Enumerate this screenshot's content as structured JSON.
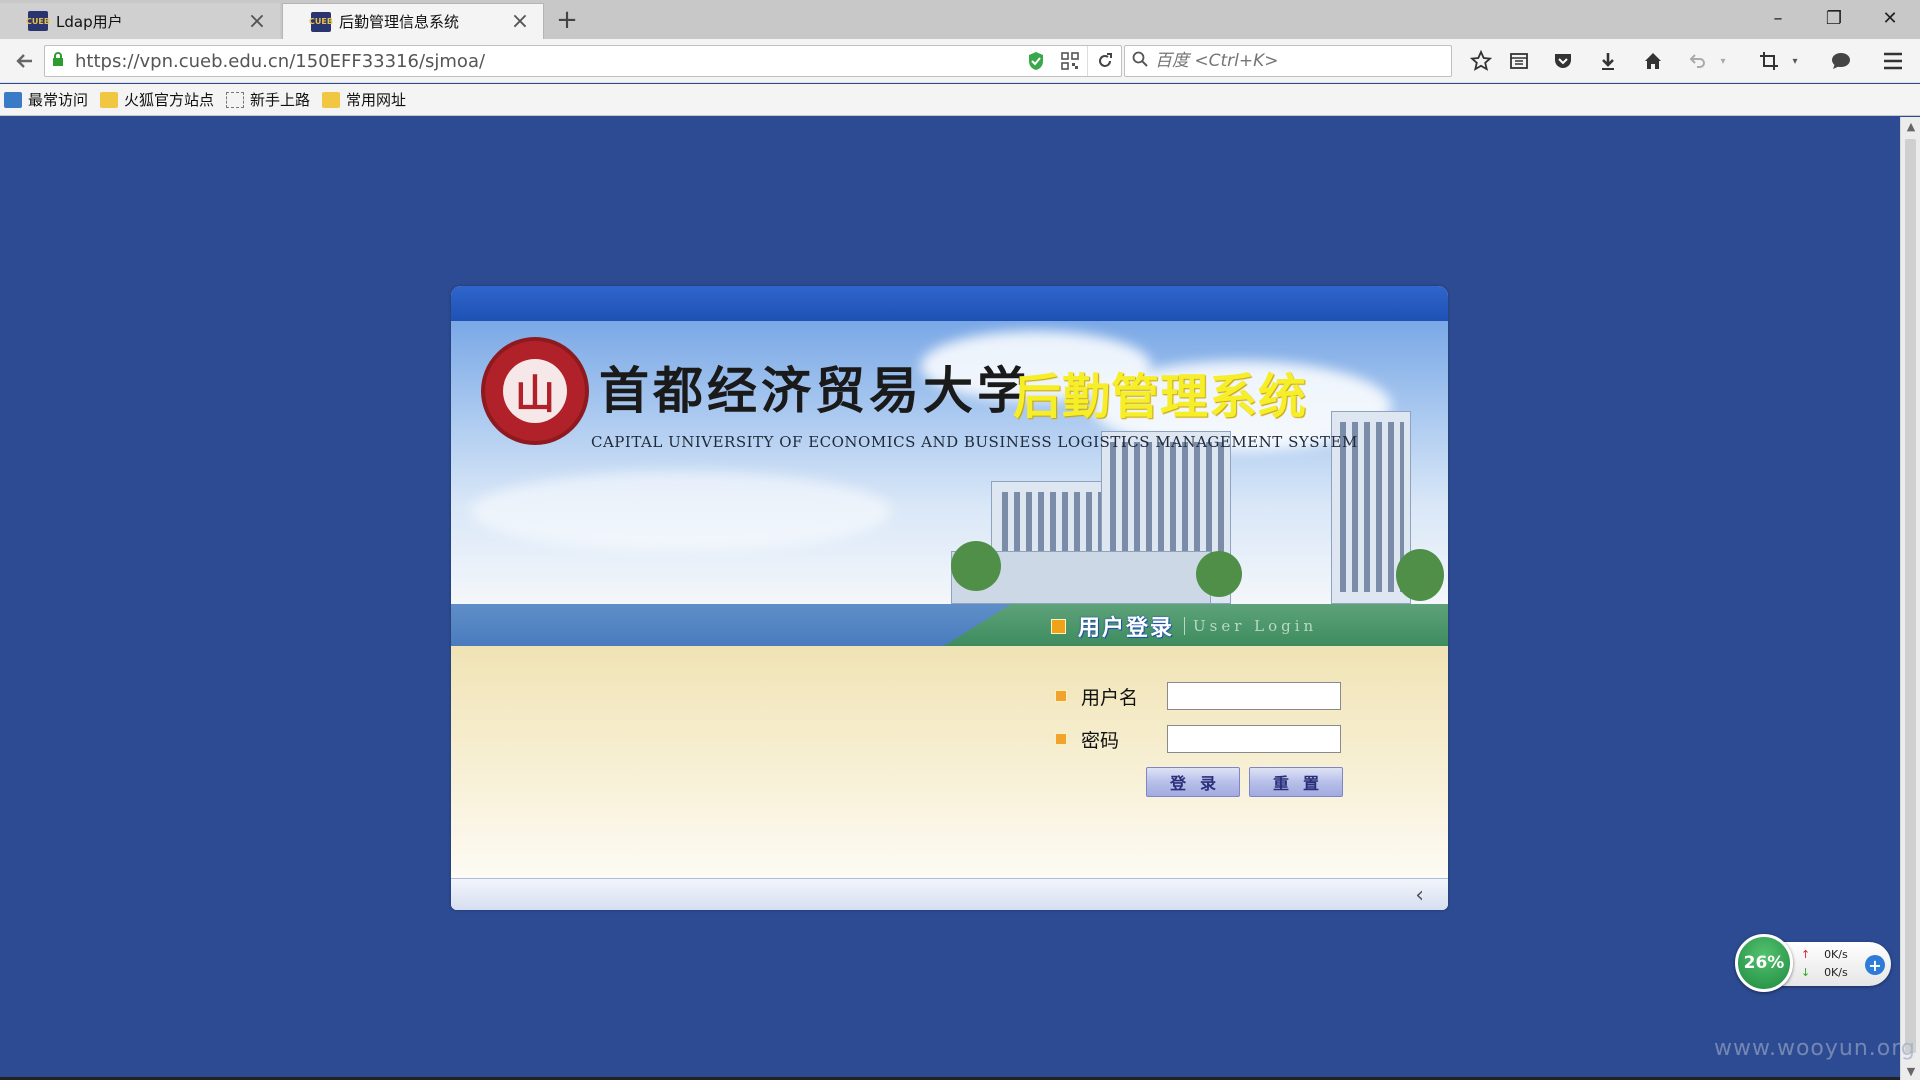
{
  "browser": {
    "tabs": [
      {
        "label": "Ldap用户",
        "favicon": "cueb-favicon",
        "active": false
      },
      {
        "label": "后勤管理信息系统",
        "favicon": "cueb-favicon",
        "active": true
      }
    ],
    "favicon_text": "CUEB",
    "new_tab_glyph": "+",
    "window_controls": {
      "minimize": "–",
      "restore": "❐",
      "close": "✕"
    },
    "url": "https://vpn.cueb.edu.cn/150EFF33316/sjmoa/",
    "search_placeholder": "百度 <Ctrl+K>",
    "bookmarks": [
      {
        "label": "最常访问",
        "icon": "bookmark-icon"
      },
      {
        "label": "火狐官方站点",
        "icon": "folder-icon"
      },
      {
        "label": "新手上路",
        "icon": "blank-page-icon"
      },
      {
        "label": "常用网址",
        "icon": "folder-icon"
      }
    ]
  },
  "banner": {
    "seal_glyph": "山",
    "university_cn": "首都经济贸易大学",
    "system_cn": "后勤管理系统",
    "university_en": "CAPITAL UNIVERSITY OF ECONOMICS AND BUSINESS   LOGISTICS MANAGEMENT SYSTEM"
  },
  "login": {
    "title_cn": "用户登录",
    "title_en": "User Login",
    "username_label": "用户名",
    "username_value": "",
    "password_label": "密码",
    "password_value": "",
    "login_button": "登录",
    "reset_button": "重置"
  },
  "speed_widget": {
    "percent": "26%",
    "upload": "0K/s",
    "download": "0K/s"
  },
  "watermark": "www.wooyun.org",
  "colors": {
    "page_background": "#2d4b93",
    "panel_top": "#1f51b4",
    "login_strip": "#3d8c5e",
    "system_title": "#f7ee2a"
  }
}
